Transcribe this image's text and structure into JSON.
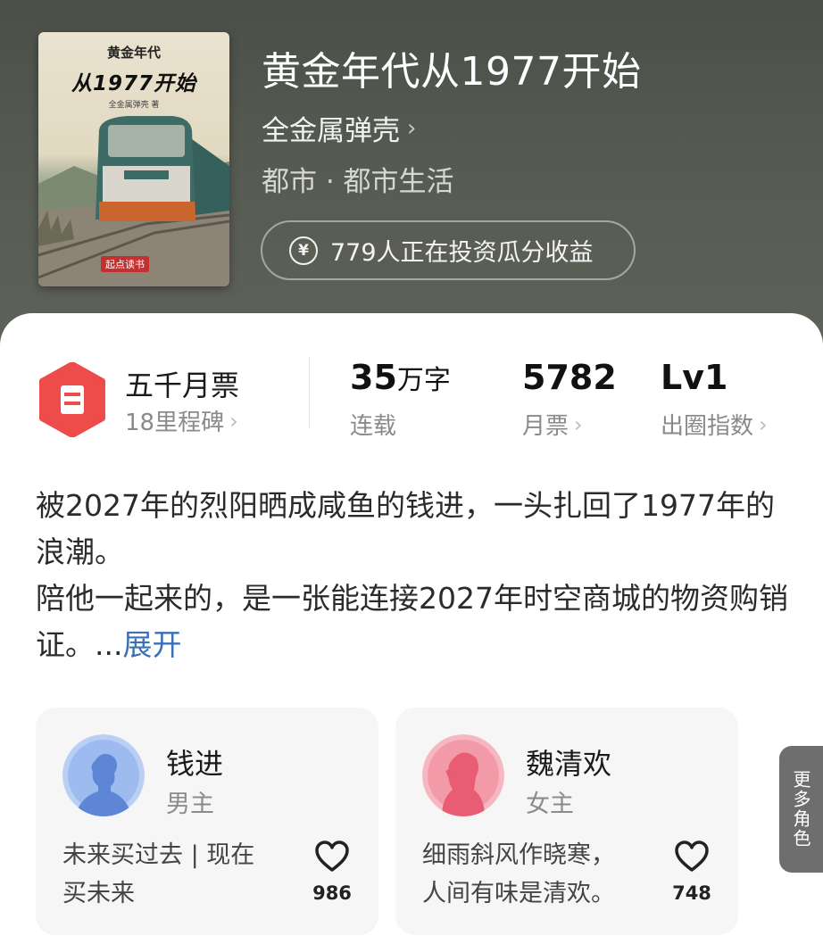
{
  "book": {
    "cover_title_line1": "黄金年代",
    "cover_title_line2": "从1977开始",
    "cover_author": "全金属弹壳 著",
    "cover_brand": "起点读书",
    "title": "黄金年代从1977开始",
    "author": "全金属弹壳",
    "genre": "都市 · 都市生活",
    "invest_text": "779人正在投资瓜分收益",
    "yen_symbol": "¥"
  },
  "stats": {
    "badge_title": "五千月票",
    "badge_sub": "18里程碑",
    "word_count": "35",
    "word_unit": "万字",
    "status": "连载",
    "monthly_votes": "5782",
    "monthly_votes_label": "月票",
    "level": "Lv1",
    "level_label": "出圈指数"
  },
  "synopsis": {
    "para1": "被2027年的烈阳晒成咸鱼的钱进，一头扎回了1977年的浪潮。",
    "para2": "陪他一起来的，是一张能连接2027年时空商城的物资购销证。...",
    "expand": "展开"
  },
  "characters": [
    {
      "name": "钱进",
      "role": "男主",
      "desc": "未来买过去 | 现在买未来",
      "likes": "986",
      "color": "#8fb1ea"
    },
    {
      "name": "魏清欢",
      "role": "女主",
      "desc": "细雨斜风作晓寒，人间有味是清欢。",
      "likes": "748",
      "color": "#f08a9a"
    }
  ],
  "more_roles": "更多角色",
  "colors": {
    "accent_blue": "#3b6fb6",
    "badge_red": "#ee4b4b"
  }
}
